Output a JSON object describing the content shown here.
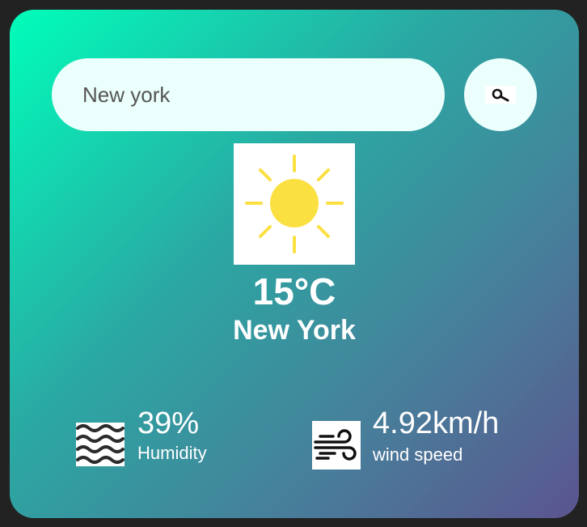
{
  "search": {
    "value": "New york",
    "button_icon": "search-icon"
  },
  "weather": {
    "icon": "sun-icon",
    "temperature": "15°C",
    "city": "New York"
  },
  "details": {
    "humidity": {
      "icon": "humidity-waves-icon",
      "value": "39%",
      "label": "Humidity"
    },
    "wind": {
      "icon": "wind-icon",
      "value": "4.92km/h",
      "label": "wind speed"
    }
  },
  "colors": {
    "page_background": "#222222",
    "gradient_start": "#00feba",
    "gradient_end": "#5b548f",
    "input_background": "#ebfffc",
    "sun": "#fbe041"
  }
}
